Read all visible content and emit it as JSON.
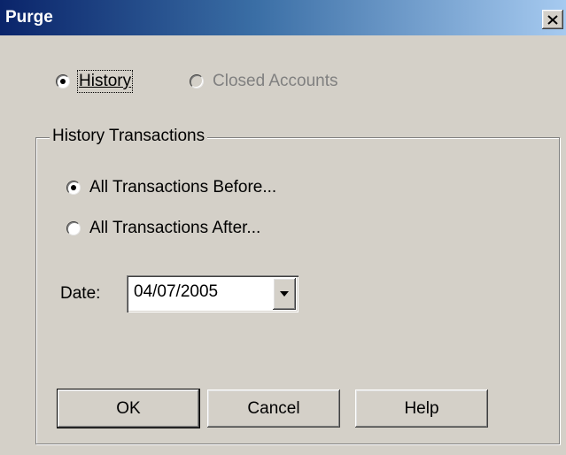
{
  "window": {
    "title": "Purge"
  },
  "top_options": [
    {
      "label": "History",
      "selected": true,
      "enabled": true
    },
    {
      "label": "Closed Accounts",
      "selected": false,
      "enabled": false
    }
  ],
  "history_group": {
    "label": "History Transactions",
    "options": [
      {
        "label": "All Transactions Before...",
        "selected": true
      },
      {
        "label": "All Transactions After...",
        "selected": false
      }
    ],
    "date_label": "Date:",
    "date_value": "04/07/2005"
  },
  "buttons": {
    "ok": "OK",
    "cancel": "Cancel",
    "help": "Help"
  },
  "icons": {
    "close": "close-icon",
    "dropdown": "chevron-down-icon"
  }
}
